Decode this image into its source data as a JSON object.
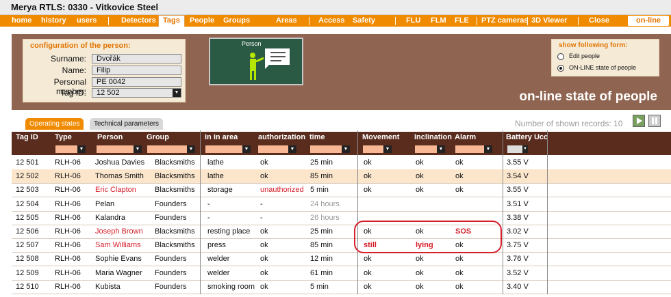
{
  "app_title": "Merya RTLS:  0330 - Vitkovice Steel",
  "menu": [
    "home",
    "history",
    "users",
    "Detectors",
    "Tags",
    "People",
    "Groups",
    "Areas",
    "Access",
    "Safety",
    "FLU",
    "FLM",
    "FLE",
    "PTZ cameras",
    "3D Viewer",
    "Close",
    "on-line"
  ],
  "config": {
    "title": "configuration of the person:",
    "surname_label": "Surname:",
    "surname": "Dvořák",
    "name_label": "Name:",
    "name": "Filip",
    "pn_label": "Personal number:",
    "pn": "PE 0042",
    "tag_label": "Tag ID:",
    "tag": "12 502"
  },
  "illus_label": "Person",
  "form": {
    "title": "show following form:",
    "opt1": "Edit people",
    "opt2": "ON-LINE state of people"
  },
  "page_title": "on-line state of people",
  "tabs": [
    "Operating states",
    "Technical parameters"
  ],
  "records": "Number of shown records: 10",
  "columns": [
    "Tag ID",
    "Type",
    "Person",
    "Group",
    "in in area",
    "authorization",
    "time",
    "Movement",
    "Inclination",
    "Alarm",
    "Battery Ucc"
  ],
  "rows": [
    {
      "tag": "12 501",
      "type": "RLH-06",
      "person": "Joshua  Davies",
      "group": "Blacksmiths",
      "area": "lathe",
      "auth": "ok",
      "time": "25 min",
      "move": "ok",
      "incl": "ok",
      "alarm": "ok",
      "bat": "3.55 V"
    },
    {
      "tag": "12 502",
      "type": "RLH-06",
      "person": "Thomas Smith",
      "group": "Blacksmiths",
      "area": "lathe",
      "auth": "ok",
      "time": "85 min",
      "move": "ok",
      "incl": "ok",
      "alarm": "ok",
      "bat": "3.54 V"
    },
    {
      "tag": "12 503",
      "type": "RLH-06",
      "person": "Eric Clapton",
      "group": "Blacksmiths",
      "area": "storage",
      "auth": "unauthorized",
      "time": "5 min",
      "move": "ok",
      "incl": "ok",
      "alarm": "ok",
      "bat": "3.55 V"
    },
    {
      "tag": "12 504",
      "type": "RLH-06",
      "person": "Pelan",
      "group": "Founders",
      "area": "-",
      "auth": "-",
      "time": "24 hours",
      "move": "",
      "incl": "",
      "alarm": "",
      "bat": "3.51 V"
    },
    {
      "tag": "12 505",
      "type": "RLH-06",
      "person": "Kalandra",
      "group": "Founders",
      "area": "-",
      "auth": "-",
      "time": "26 hours",
      "move": "",
      "incl": "",
      "alarm": "",
      "bat": "3.38 V"
    },
    {
      "tag": "12 506",
      "type": "RLH-06",
      "person": "Joseph Brown",
      "group": "Blacksmiths",
      "area": "resting place",
      "auth": "ok",
      "time": "25 min",
      "move": "ok",
      "incl": "ok",
      "alarm": "SOS",
      "bat": "3.02 V"
    },
    {
      "tag": "12 507",
      "type": "RLH-06",
      "person": "Sam Williams",
      "group": "Blacksmiths",
      "area": "press",
      "auth": "ok",
      "time": "85 min",
      "move": "still",
      "incl": "lying",
      "alarm": "ok",
      "bat": "3.75 V"
    },
    {
      "tag": "12 508",
      "type": "RLH-06",
      "person": "Sophie Evans",
      "group": "Founders",
      "area": "welder",
      "auth": "ok",
      "time": "12 min",
      "move": "ok",
      "incl": "ok",
      "alarm": "ok",
      "bat": "3.76 V"
    },
    {
      "tag": "12 509",
      "type": "RLH-06",
      "person": "Maria Wagner",
      "group": "Founders",
      "area": "welder",
      "auth": "ok",
      "time": "61 min",
      "move": "ok",
      "incl": "ok",
      "alarm": "ok",
      "bat": "3.52 V"
    },
    {
      "tag": "12 510",
      "type": "RLH-06",
      "person": "Kubista",
      "group": "Founders",
      "area": "smoking room",
      "auth": "ok",
      "time": "5 min",
      "move": "ok",
      "incl": "ok",
      "alarm": "ok",
      "bat": "3.40 V"
    }
  ],
  "colors": {
    "accent": "#f08a00",
    "alert": "#d6202a",
    "header": "#5a2c1e",
    "panel": "#8f6450"
  }
}
